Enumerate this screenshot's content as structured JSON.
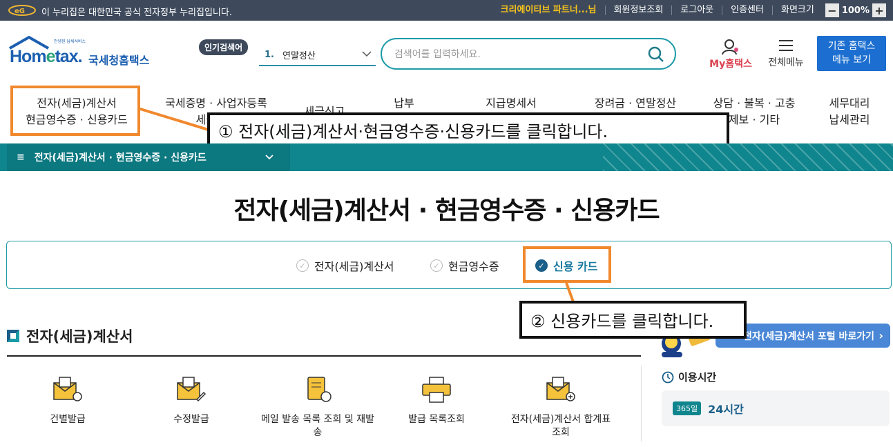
{
  "topbar": {
    "gov_notice": "이 누리집은 대한민국 공식 전자정부 누리집입니다.",
    "user_name": "크리에이티브 파트너...님",
    "links": [
      "회원정보조회",
      "로그아웃",
      "인증센터",
      "화면크기"
    ],
    "zoom_minus": "−",
    "zoom_value": "100%",
    "zoom_plus": "+"
  },
  "header": {
    "logo_sub": "안녕된 납세서비스",
    "logo_main_1": "Hom",
    "logo_main_e": "e",
    "logo_main_2": "tax.",
    "logo_kr": "국세청홈택스",
    "popular_badge": "인기검색어",
    "popular_num": "1.",
    "popular_term": "연말정산",
    "search_placeholder": "검색어를 입력하세요.",
    "my_hometax": "My홈택스",
    "all_menu": "전체메뉴",
    "old_hometax_line1": "기존 홈택스",
    "old_hometax_line2": "메뉴 보기"
  },
  "gnb": {
    "items": [
      {
        "line1": "전자(세금)계산서",
        "line2": "현금영수증 · 신용카드"
      },
      {
        "line1": "국세증명 · 사업자등록",
        "line2": "세금관련"
      },
      {
        "line1": "세금신고",
        "line2": ""
      },
      {
        "line1": "납부",
        "line2": ""
      },
      {
        "line1": "지급명세서",
        "line2": ""
      },
      {
        "line1": "장려금 · 연말정산",
        "line2": ""
      },
      {
        "line1": "상담 · 불복 · 고충",
        "line2": "제보 · 기타"
      },
      {
        "line1": "세무대리",
        "line2": "납세관리"
      }
    ]
  },
  "callouts": {
    "step1": "① 전자(세금)계산서·현금영수증·신용카드를 클릭합니다.",
    "step2": "② 신용카드를 클릭합니다."
  },
  "breadcrumb": {
    "menu_icon": "≡",
    "label": "전자(세금)계산서 · 현금영수증 · 신용카드"
  },
  "page_title": "전자(세금)계산서 · 현금영수증 · 신용카드",
  "tabs": [
    {
      "label": "전자(세금)계산서",
      "active": false
    },
    {
      "label": "현금영수증",
      "active": false
    },
    {
      "label": "신용 카드",
      "active": true
    }
  ],
  "section": {
    "title": "전자(세금)계산서",
    "portal_button": "전자(세금)계산서 포털 바로가기"
  },
  "services": [
    {
      "label": "건별발급",
      "icon": "envelope-gear-icon"
    },
    {
      "label": "수정발급",
      "icon": "envelope-edit-icon"
    },
    {
      "label": "메일 발송 목록 조회 및 재발송",
      "icon": "scroll-mail-icon"
    },
    {
      "label": "발급 목록조회",
      "icon": "printer-icon"
    },
    {
      "label": "전자(세금)계산서 합계표 조회",
      "icon": "envelope-plus-icon"
    }
  ],
  "hours": {
    "title": "이용시간",
    "badge": "365일",
    "value": "24시간"
  },
  "colors": {
    "teal": "#0f858d",
    "highlight": "#f0892e",
    "brand_blue": "#1c5fb0"
  }
}
